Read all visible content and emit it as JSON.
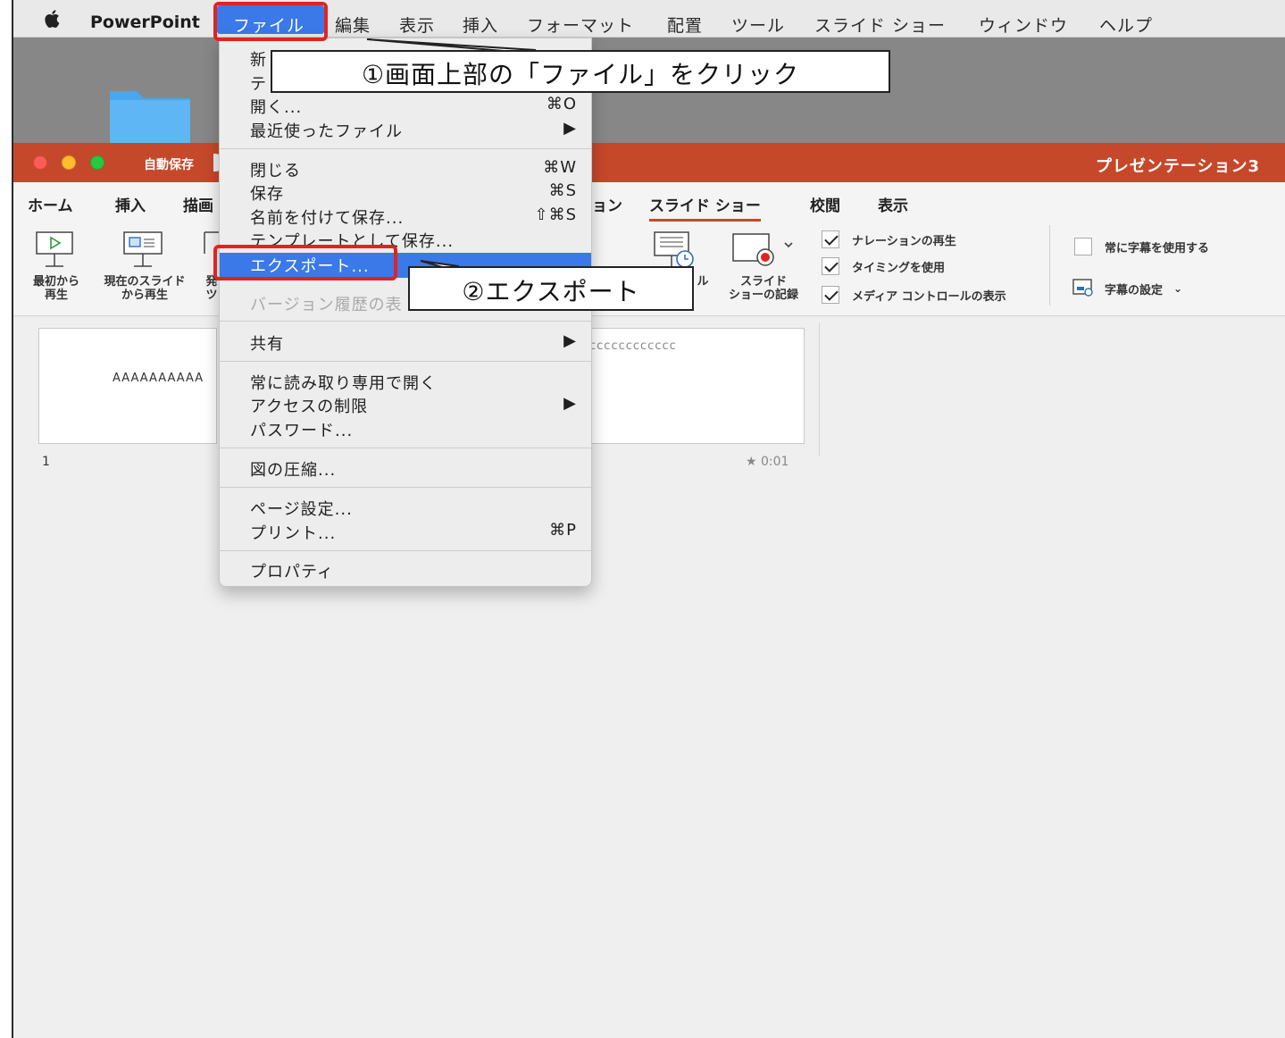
{
  "menubar": {
    "app": "PowerPoint",
    "items": [
      "ファイル",
      "編集",
      "表示",
      "挿入",
      "フォーマット",
      "配置",
      "ツール",
      "スライド ショー",
      "ウィンドウ",
      "ヘルプ"
    ]
  },
  "window": {
    "autosave": "自動保存",
    "doc_title": "プレゼンテーション3"
  },
  "ribbon": {
    "tabs": [
      "ホーム",
      "挿入",
      "描画",
      "ョン",
      "スライド ショー",
      "校閲",
      "表示"
    ],
    "play_from_start": [
      "最初から",
      "再生"
    ],
    "play_from_current": [
      "現在のスライド",
      "から再生"
    ],
    "partial_label_1": "発",
    "partial_label_2": "ツ",
    "rehearse_partial": "ル",
    "record": [
      "スライド",
      "ショーの記録"
    ],
    "options": [
      {
        "label": "ナレーションの再生",
        "checked": true
      },
      {
        "label": "タイミングを使用",
        "checked": true
      },
      {
        "label": "メディア コントロールの表示",
        "checked": true
      }
    ],
    "captions_always": {
      "label": "常に字幕を使用する",
      "checked": false
    },
    "caption_settings": "字幕の設定"
  },
  "slides": [
    {
      "num": "1",
      "text": "AAAAAAAAAA"
    },
    {
      "num": "",
      "text": "cccccccccccc",
      "timing": "★ 0:01"
    }
  ],
  "file_menu": {
    "partial_top_1": "新",
    "partial_top_2": "テ",
    "items_a": [
      {
        "label": "開く...",
        "shortcut": "⌘O"
      },
      {
        "label": "最近使ったファイル",
        "shortcut": "▶"
      }
    ],
    "items_b": [
      {
        "label": "閉じる",
        "shortcut": "⌘W"
      },
      {
        "label": "保存",
        "shortcut": "⌘S"
      },
      {
        "label": "名前を付けて保存...",
        "shortcut": "⇧⌘S"
      },
      {
        "label": "テンプレートとして保存...",
        "shortcut": ""
      }
    ],
    "export": "エクスポート...",
    "version_history": "バージョン履歴の表",
    "share": {
      "label": "共有",
      "shortcut": "▶"
    },
    "items_c": [
      {
        "label": "常に読み取り専用で開く",
        "shortcut": ""
      },
      {
        "label": "アクセスの制限",
        "shortcut": "▶"
      },
      {
        "label": "パスワード...",
        "shortcut": ""
      }
    ],
    "compress": "図の圧縮...",
    "items_d": [
      {
        "label": "ページ設定...",
        "shortcut": ""
      },
      {
        "label": "プリント...",
        "shortcut": "⌘P"
      }
    ],
    "properties": "プロパティ"
  },
  "annotations": {
    "step1": "①画面上部の「ファイル」をクリック",
    "step2": "②エクスポート"
  },
  "colors": {
    "accent": "#c6482b",
    "highlight": "#3b78e8",
    "annotation_red": "#e1231e"
  }
}
